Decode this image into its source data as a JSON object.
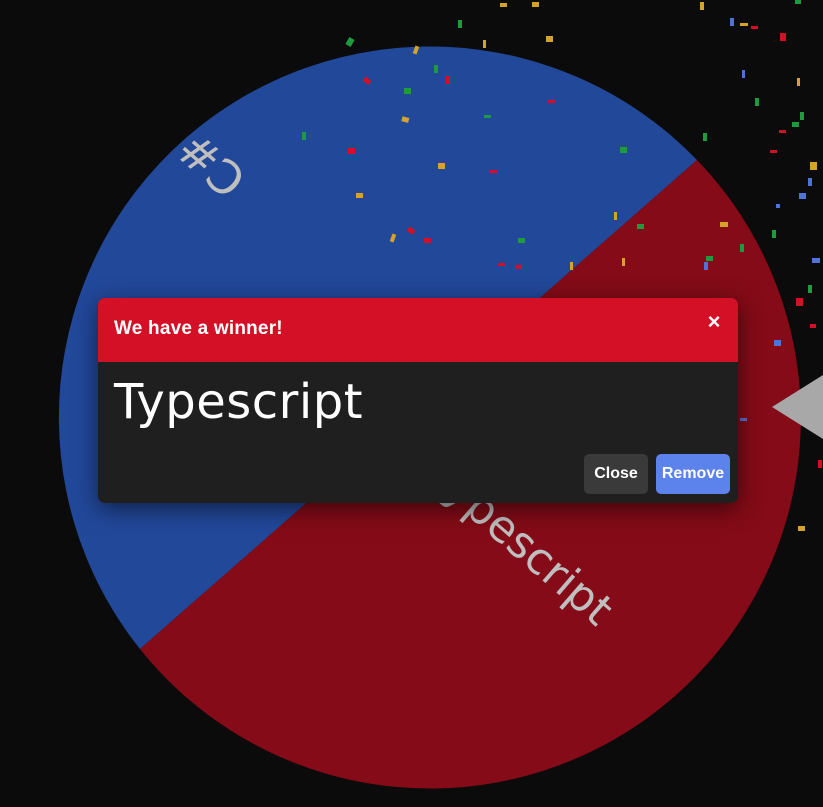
{
  "colors": {
    "background": "#0b0b0b",
    "segment_blue": "#22489a",
    "segment_red": "#840b17",
    "header_red": "#d41026",
    "remove_blue": "#5c83eb",
    "close_gray": "#3a3a3a",
    "pointer_gray": "#a8a8a8"
  },
  "wheel": {
    "segments": [
      {
        "label": "C#",
        "color_key": "segment_blue"
      },
      {
        "label": "Typescript",
        "color_key": "segment_red"
      }
    ]
  },
  "modal": {
    "title": "We have a winner!",
    "close_icon": "×",
    "winner": "Typescript",
    "close_button": "Close",
    "remove_button": "Remove"
  }
}
